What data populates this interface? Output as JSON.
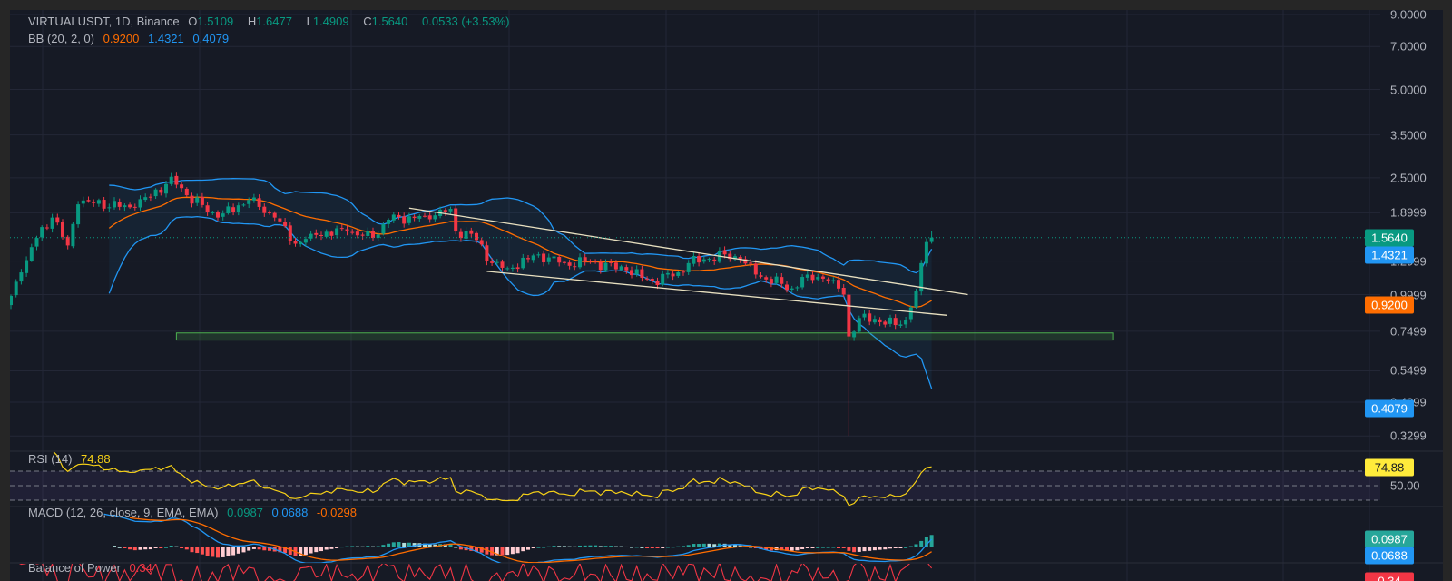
{
  "header": {
    "symbol": "VIRTUALUSDT, 1D, Binance",
    "o_label": "O",
    "o": "1.5109",
    "h_label": "H",
    "h": "1.6477",
    "l_label": "L",
    "l": "1.4909",
    "c_label": "C",
    "c": "1.5640",
    "change": "0.0533 (+3.53%)"
  },
  "bb": {
    "label": "BB (20, 2, 0)",
    "basis": "0.9200",
    "upper": "1.4321",
    "lower": "0.4079"
  },
  "rsi": {
    "label": "RSI (14)",
    "value": "74.88",
    "mid": "50.00"
  },
  "macd": {
    "label": "MACD (12, 26, close, 9, EMA, EMA)",
    "hist": "0.0987",
    "macd": "0.0688",
    "signal": "-0.0298",
    "tag_hist": "0.0987",
    "tag_macd": "0.0688"
  },
  "bop": {
    "label": "Balance of Power",
    "value": "0.34"
  },
  "price_axis": {
    "ticks": [
      "9.0000",
      "7.0000",
      "5.0000",
      "3.5000",
      "2.5000",
      "1.8999",
      "1.2999",
      "0.9999",
      "0.7499",
      "0.5499",
      "0.4299",
      "0.3299"
    ],
    "tag_close": "1.5640",
    "tag_upper": "1.4321",
    "tag_basis": "0.9200",
    "tag_lower": "0.4079"
  },
  "colors": {
    "up": "#089981",
    "down": "#f23645",
    "basis": "#ff6d00",
    "band": "#2196f3",
    "rsi": "#f7d117",
    "trendline": "#e8e0c0",
    "zone": "#4caf50"
  },
  "chart_data": {
    "type": "candlestick",
    "scale": "log",
    "ylim": [
      0.32,
      9.0
    ],
    "interval": "1D",
    "close_keypoints": [
      [
        0,
        0.99
      ],
      [
        2,
        1.19
      ],
      [
        5,
        1.56
      ],
      [
        8,
        1.83
      ],
      [
        11,
        1.47
      ],
      [
        13,
        2.03
      ],
      [
        15,
        2.08
      ],
      [
        21,
        1.99
      ],
      [
        24,
        1.99
      ],
      [
        30,
        2.38
      ],
      [
        31,
        2.52
      ],
      [
        34,
        2.18
      ],
      [
        40,
        1.83
      ],
      [
        46,
        2.1
      ],
      [
        51,
        1.83
      ],
      [
        55,
        1.49
      ],
      [
        58,
        1.61
      ],
      [
        65,
        1.64
      ],
      [
        70,
        1.56
      ],
      [
        73,
        1.8
      ],
      [
        80,
        1.85
      ],
      [
        85,
        1.96
      ],
      [
        86,
        1.64
      ],
      [
        89,
        1.61
      ],
      [
        93,
        1.28
      ],
      [
        96,
        1.23
      ],
      [
        102,
        1.37
      ],
      [
        107,
        1.28
      ],
      [
        112,
        1.3
      ],
      [
        119,
        1.21
      ],
      [
        124,
        1.11
      ],
      [
        129,
        1.19
      ],
      [
        131,
        1.28
      ],
      [
        138,
        1.37
      ],
      [
        141,
        1.32
      ],
      [
        144,
        1.17
      ],
      [
        151,
        1.05
      ],
      [
        154,
        1.17
      ],
      [
        159,
        1.12
      ],
      [
        161,
        1.0
      ],
      [
        162,
        0.72
      ],
      [
        165,
        0.86
      ],
      [
        169,
        0.79
      ],
      [
        173,
        0.82
      ],
      [
        175,
        1.03
      ],
      [
        176,
        1.28
      ],
      [
        177,
        1.51
      ],
      [
        178,
        1.564
      ]
    ],
    "wick_low": {
      "day": 162,
      "low": 0.33
    },
    "last_candle": {
      "open": 1.5109,
      "high": 1.6477,
      "low": 1.4909,
      "close": 1.564
    },
    "trendlines": [
      {
        "from": [
          77,
          1.97
        ],
        "to": [
          185,
          1.0
        ]
      },
      {
        "from": [
          92,
          1.2
        ],
        "to": [
          181,
          0.85
        ]
      }
    ],
    "support_zone": {
      "from_day": 32,
      "to_day": 213,
      "low": 0.7,
      "high": 0.74
    },
    "rsi_levels": [
      70,
      50,
      30
    ]
  }
}
